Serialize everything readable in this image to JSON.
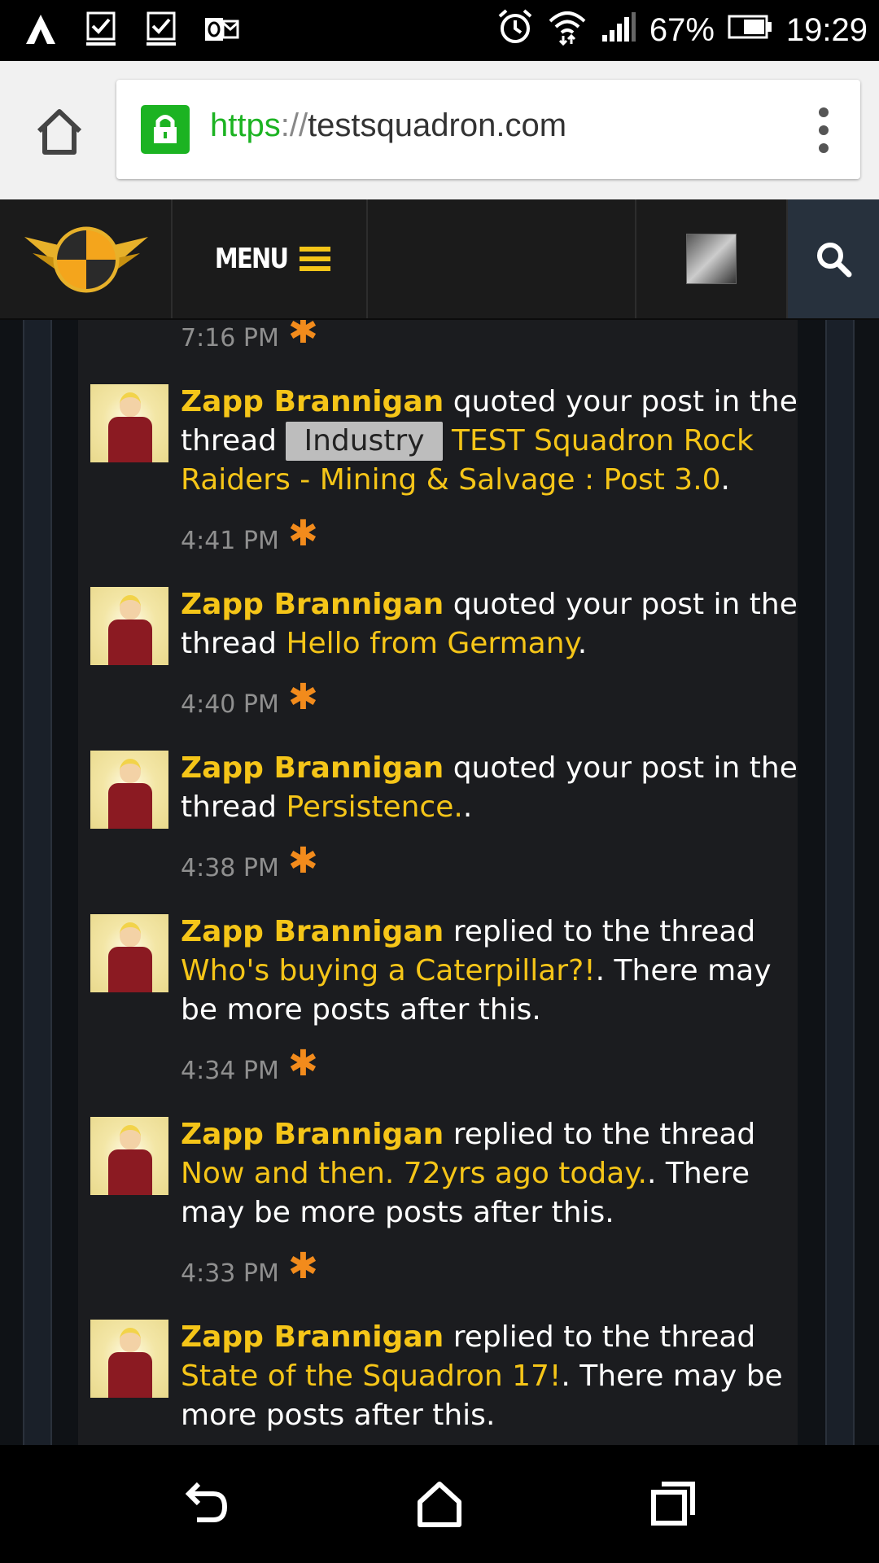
{
  "status_bar": {
    "left_icons": [
      "app-a-icon",
      "checklist-icon",
      "checklist-icon",
      "outlook-icon"
    ],
    "battery": "67%",
    "time": "19:29"
  },
  "browser": {
    "url_scheme": "https",
    "url_sep": "://",
    "url_host": "testsquadron.com"
  },
  "header": {
    "menu_label": "MENU"
  },
  "notifications": [
    {
      "time": "7:16 PM"
    },
    {
      "user": "Zapp Brannigan",
      "action": " quoted your post in the thread ",
      "prefix": "Industry",
      "thread": "TEST Squadron Rock Raiders - Mining & Salvage : Post 3.0",
      "suffix": ".",
      "time": "4:41 PM"
    },
    {
      "user": "Zapp Brannigan",
      "action": " quoted your post in the thread ",
      "thread": "Hello from Germany",
      "suffix": ".",
      "time": "4:40 PM"
    },
    {
      "user": "Zapp Brannigan",
      "action": " quoted your post in the thread ",
      "thread": "Persistence.",
      "suffix": ".",
      "time": "4:38 PM"
    },
    {
      "user": "Zapp Brannigan",
      "action": " replied to the thread ",
      "thread": "Who's buying a Caterpillar?!",
      "suffix": ". There may be more posts after this.",
      "time": "4:34 PM"
    },
    {
      "user": "Zapp Brannigan",
      "action": " replied to the thread ",
      "thread": "Now and then. 72yrs ago today.",
      "suffix": ". There may be more posts after this.",
      "time": "4:33 PM"
    },
    {
      "user": "Zapp Brannigan",
      "action": " replied to the thread ",
      "thread": "State of the Squadron 17!",
      "suffix": ". There may be more posts after this."
    }
  ],
  "colors": {
    "accent": "#f5c518",
    "unread_star": "#f28b1c",
    "ssl_green": "#1cb322"
  }
}
